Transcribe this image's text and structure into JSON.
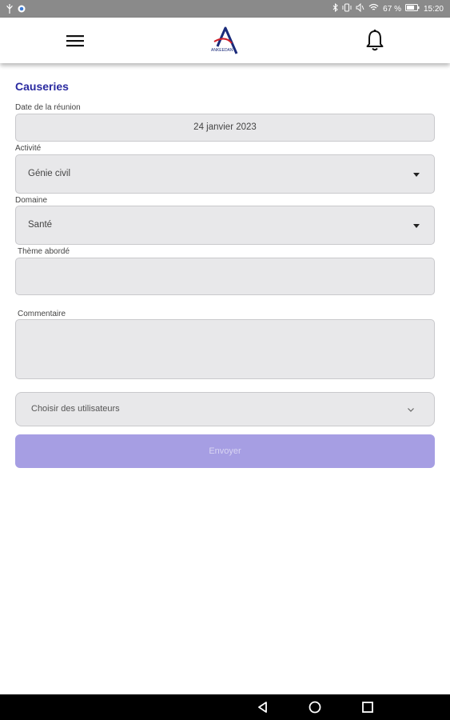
{
  "status_bar": {
    "battery_percent": "67 %",
    "time": "15:20",
    "icons": [
      "usb-icon",
      "notification-icon",
      "bluetooth-icon",
      "vibrate-icon",
      "mute-icon",
      "wifi-icon",
      "battery-icon"
    ]
  },
  "app_bar": {
    "menu_icon": "hamburger-menu-icon",
    "logo_text": "ANKEEDAN",
    "bell_icon": "bell-icon"
  },
  "form": {
    "title": "Causeries",
    "date": {
      "label": "Date de la réunion",
      "value": "24 janvier 2023"
    },
    "activity": {
      "label": "Activité",
      "value": "Génie civil"
    },
    "domain": {
      "label": "Domaine",
      "value": "Santé"
    },
    "theme": {
      "label": "Thème abordé",
      "value": ""
    },
    "comment": {
      "label": "Commentaire",
      "value": ""
    },
    "users": {
      "placeholder": "Choisir des utilisateurs"
    },
    "submit_label": "Envoyer"
  },
  "colors": {
    "title": "#2a2aa0",
    "field_bg": "#e8e8ea",
    "submit_bg": "#a69ee3",
    "status_bar": "#8a8a8a"
  },
  "nav_bar": {
    "icons": [
      "back-icon",
      "home-icon",
      "recents-icon"
    ]
  }
}
